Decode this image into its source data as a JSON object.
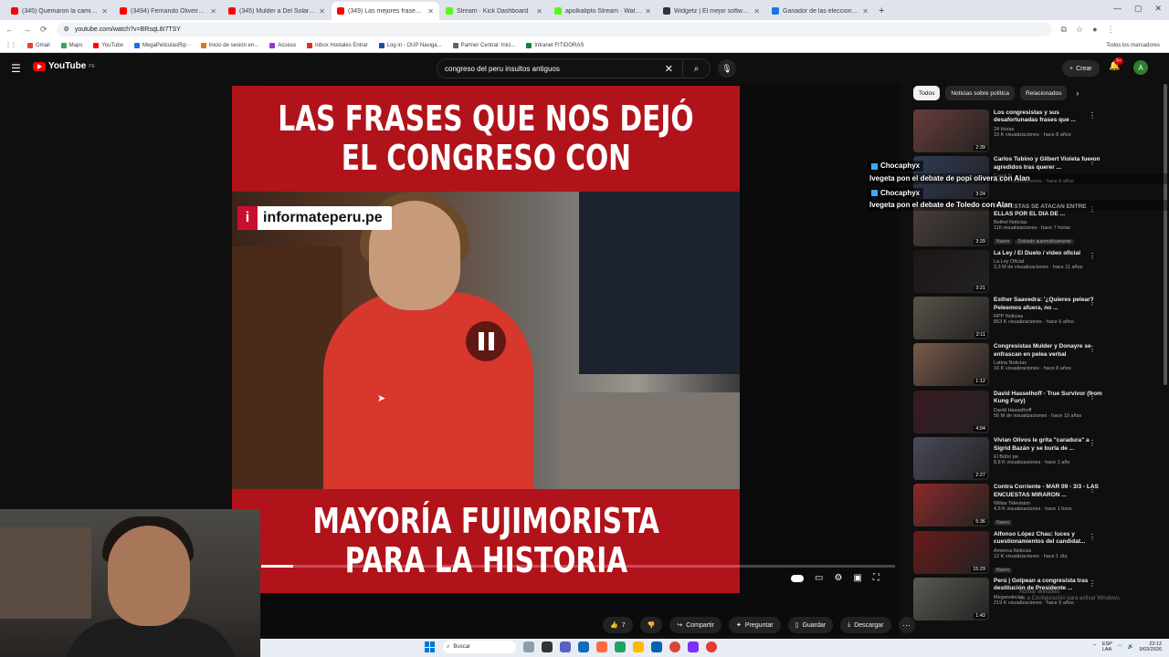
{
  "browser": {
    "tabs": [
      {
        "title": "(345) Quemaron la camiseta de M",
        "color": "#ff0000"
      },
      {
        "title": "(3494) Fernando Oliveira vs Alan",
        "color": "#ff0000"
      },
      {
        "title": "(345) Mulder a Del Solar: 'Sobr",
        "color": "#ff0000"
      },
      {
        "title": "(349) Las mejores frases de",
        "color": "#ff0000",
        "active": true
      },
      {
        "title": "Stream · Kick Dashboard",
        "color": "#53fc18"
      },
      {
        "title": "apolkalipto Stream · Watch Live",
        "color": "#53fc18"
      },
      {
        "title": "Widgetz | El mejor software pa",
        "color": "#333333"
      },
      {
        "title": "Ganador de las elecciones pres",
        "color": "#1a73e8"
      }
    ],
    "new_tab": "+",
    "url": "youtube.com/watch?v=BRsqL8I7TSY",
    "bookmarks": [
      "Gmail",
      "Maps",
      "YouTube",
      "MegaPeliculasRip -",
      "Inicio de sesión en...",
      "Acceso",
      "Inbox Hostales Entrar",
      "Log in - OUP Naviga...",
      "Partner Central: Inici...",
      "Intranet FITIDORAS"
    ],
    "bookmarks_right": "Todos los marcadores"
  },
  "youtube": {
    "logo_text": "YouTube",
    "logo_region": "PE",
    "search_query": "congreso del peru insultos  antiguos",
    "create_label": "Crear",
    "notif_count": "9+",
    "avatar_letter": "A"
  },
  "video": {
    "top_line1": "LAS FRASES QUE NOS DEJÓ",
    "top_line2": "EL CONGRESO CON",
    "badge_text": "informateperu.pe",
    "badge_icon": "i",
    "bottom_line1": "MAYORÍA FUJIMORISTA",
    "bottom_line2": "PARA LA HISTORIA",
    "progress": 0.05
  },
  "actions": {
    "likes": "7",
    "share": "Compartir",
    "ask": "Preguntar",
    "save": "Guardar",
    "download": "Descargar"
  },
  "chips": [
    "Todos",
    "Noticias sobre política",
    "Relacionados"
  ],
  "recommendations": [
    {
      "title": "Los congresistas y sus desafortunadas frases que ...",
      "channel": "24 Horas",
      "meta": "19 K visualizaciones · hace 8 años",
      "duration": "2:39",
      "thumb": "#6a3b3b"
    },
    {
      "title": "Carlos Tubino y Gilbert Violeta fueron agredidos tras querer ...",
      "channel": "Canal N",
      "meta": "344 K visualizaciones · hace 6 años",
      "duration": "3:24",
      "thumb": "#2f3a55"
    },
    {
      "title": "PROTESTAS SE ATACAN ENTRE ELLAS POR EL DIA DE ...",
      "channel": "Bethel Noticias",
      "meta": "116 visualizaciones · hace 7 horas",
      "duration": "3:29",
      "thumb": "#4a3f3a",
      "badges": [
        "Nuevo",
        "Doblado automáticamente"
      ]
    },
    {
      "title": "La Ley / El Duelo / video oficial",
      "channel": "La Ley Oficial",
      "meta": "3,3 M de visualizaciones · hace 11 años",
      "duration": "3:21",
      "thumb": "#1e1616"
    },
    {
      "title": "Esther Saavedra: '¿Quieres pelear? Peleemos afuera, no ...",
      "channel": "RPP Noticias",
      "meta": "853 K visualizaciones · hace 6 años",
      "duration": "2:11",
      "thumb": "#5a5248"
    },
    {
      "title": "Congresistas Mulder y Donayre se enfrascan en pelea verbal",
      "channel": "Latina Noticias",
      "meta": "16 K visualizaciones · hace 8 años",
      "duration": "1:12",
      "thumb": "#7a5a4a"
    },
    {
      "title": "David Hasselhoff - True Survivor (from Kung Fury)",
      "channel": "David Hasselhoff",
      "meta": "56 M de visualizaciones · hace 10 años",
      "duration": "4:04",
      "thumb": "#3a1a22"
    },
    {
      "title": "Vivian Olivos le grita \"caradura\" a Sigrid Bazán y se burla de ...",
      "channel": "El Búho pe",
      "meta": "8,8 K visualizaciones · hace 1 año",
      "duration": "2:27",
      "thumb": "#4a4a5a"
    },
    {
      "title": "Contra Corriente - MAR 09 - 3/3 - LAS ENCUESTAS MIRARON ...",
      "channel": "Willax Television",
      "meta": "4,5 K visualizaciones · hace 1 hora",
      "duration": "5:36",
      "thumb": "#8a2a2a",
      "badges": [
        "Nuevo"
      ]
    },
    {
      "title": "Alfonso López Chau: luces y cuestionamientos del candidat...",
      "channel": "America Noticias",
      "meta": "12 K visualizaciones · hace 1 día",
      "duration": "15:29",
      "thumb": "#6a1a1a",
      "badges": [
        "Nuevo"
      ]
    },
    {
      "title": "Perú | Golpean a congresista tras destitución de Presidente ...",
      "channel": "Meganoticias",
      "meta": "219 K visualizaciones · hace 5 años",
      "duration": "1:43",
      "thumb": "#5a5a52"
    }
  ],
  "chat": [
    {
      "user": "Chocaphyx",
      "text": "Ivegeta pon el debate de popi olivera con Alan"
    },
    {
      "user": "Chocaphyx",
      "text": "Ivegeta pon el debate de Toledo con Alan"
    }
  ],
  "watermark": "Activar Windows\nVe a Configuración para activar Windows.",
  "taskbar": {
    "search": "Buscar",
    "lang": "ESP\nLAA",
    "time": "23:12",
    "date": "9/03/2026"
  }
}
